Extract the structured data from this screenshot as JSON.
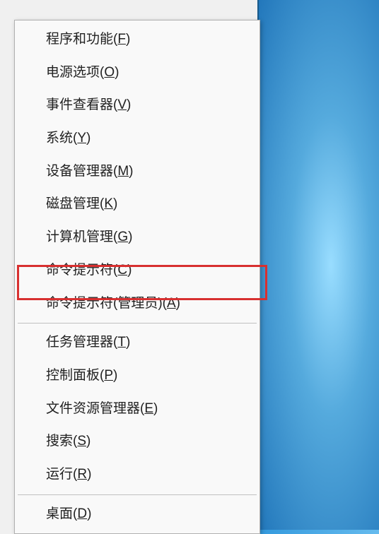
{
  "menu": {
    "groups": [
      [
        {
          "label": "程序和功能",
          "mnemonic": "F",
          "name": "menu-programs-features"
        },
        {
          "label": "电源选项",
          "mnemonic": "O",
          "name": "menu-power-options"
        },
        {
          "label": "事件查看器",
          "mnemonic": "V",
          "name": "menu-event-viewer"
        },
        {
          "label": "系统",
          "mnemonic": "Y",
          "name": "menu-system"
        },
        {
          "label": "设备管理器",
          "mnemonic": "M",
          "name": "menu-device-manager"
        },
        {
          "label": "磁盘管理",
          "mnemonic": "K",
          "name": "menu-disk-management"
        },
        {
          "label": "计算机管理",
          "mnemonic": "G",
          "name": "menu-computer-management"
        },
        {
          "label": "命令提示符",
          "mnemonic": "C",
          "name": "menu-command-prompt"
        },
        {
          "label": "命令提示符(管理员)",
          "mnemonic": "A",
          "name": "menu-command-prompt-admin",
          "highlighted": true
        }
      ],
      [
        {
          "label": "任务管理器",
          "mnemonic": "T",
          "name": "menu-task-manager"
        },
        {
          "label": "控制面板",
          "mnemonic": "P",
          "name": "menu-control-panel"
        },
        {
          "label": "文件资源管理器",
          "mnemonic": "E",
          "name": "menu-file-explorer"
        },
        {
          "label": "搜索",
          "mnemonic": "S",
          "name": "menu-search"
        },
        {
          "label": "运行",
          "mnemonic": "R",
          "name": "menu-run"
        }
      ],
      [
        {
          "label": "桌面",
          "mnemonic": "D",
          "name": "menu-desktop"
        }
      ]
    ]
  }
}
